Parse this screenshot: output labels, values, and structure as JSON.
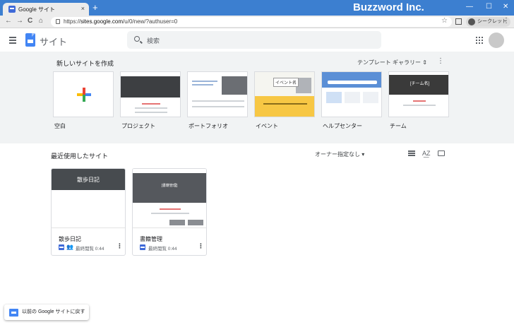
{
  "browser": {
    "tab_title": "Google サイト",
    "tab_close": "×",
    "new_tab": "+",
    "brand": "Buzzword Inc.",
    "window_controls": [
      "—",
      "☐",
      "✕"
    ],
    "nav": {
      "back": "←",
      "forward": "→",
      "reload": "C",
      "home": "⌂"
    },
    "url_prefix": "https://",
    "url_host": "sites.google.com",
    "url_path": "/u/0/new/?authuser=0",
    "bookmark_icon": "star-icon",
    "bookmark_glyph": "☆",
    "incognito_label": "シークレット",
    "menu_glyph": "⋮"
  },
  "header": {
    "app_title": "サイト",
    "search_placeholder": "検索"
  },
  "gallery": {
    "title": "新しいサイトを作成",
    "template_gallery_label": "テンプレート ギャラリー",
    "template_gallery_glyph": "⇕",
    "more_glyph": "⋮",
    "templates": [
      {
        "label": "空白"
      },
      {
        "label": "プロジェクト"
      },
      {
        "label": "ポートフォリオ"
      },
      {
        "label": "イベント",
        "preview_title": "イベント名"
      },
      {
        "label": "ヘルプセンター"
      },
      {
        "label": "チーム",
        "preview_title": "[チーム名]"
      }
    ]
  },
  "recent": {
    "title": "最近使用したサイト",
    "owner_filter": "オーナー指定なし ▾",
    "sort_glyph": "A͟Z",
    "sites": [
      {
        "name": "散歩日記",
        "banner": "散歩日記",
        "opened": "最終閲覧 0:44",
        "menu_glyph": "⋮",
        "shared": true
      },
      {
        "name": "書籍管理",
        "banner": "[書籍管理]",
        "opened": "最終閲覧 0:44",
        "menu_glyph": "⋮",
        "shared": false
      }
    ]
  },
  "footer": {
    "legacy_link": "以前の Google サイトに戻す"
  },
  "colors": {
    "titlebar": "#3c7fd0",
    "accent_blue": "#4285f4",
    "plus_red": "#ea4335",
    "plus_yellow": "#fbbc05",
    "plus_green": "#34a853"
  }
}
